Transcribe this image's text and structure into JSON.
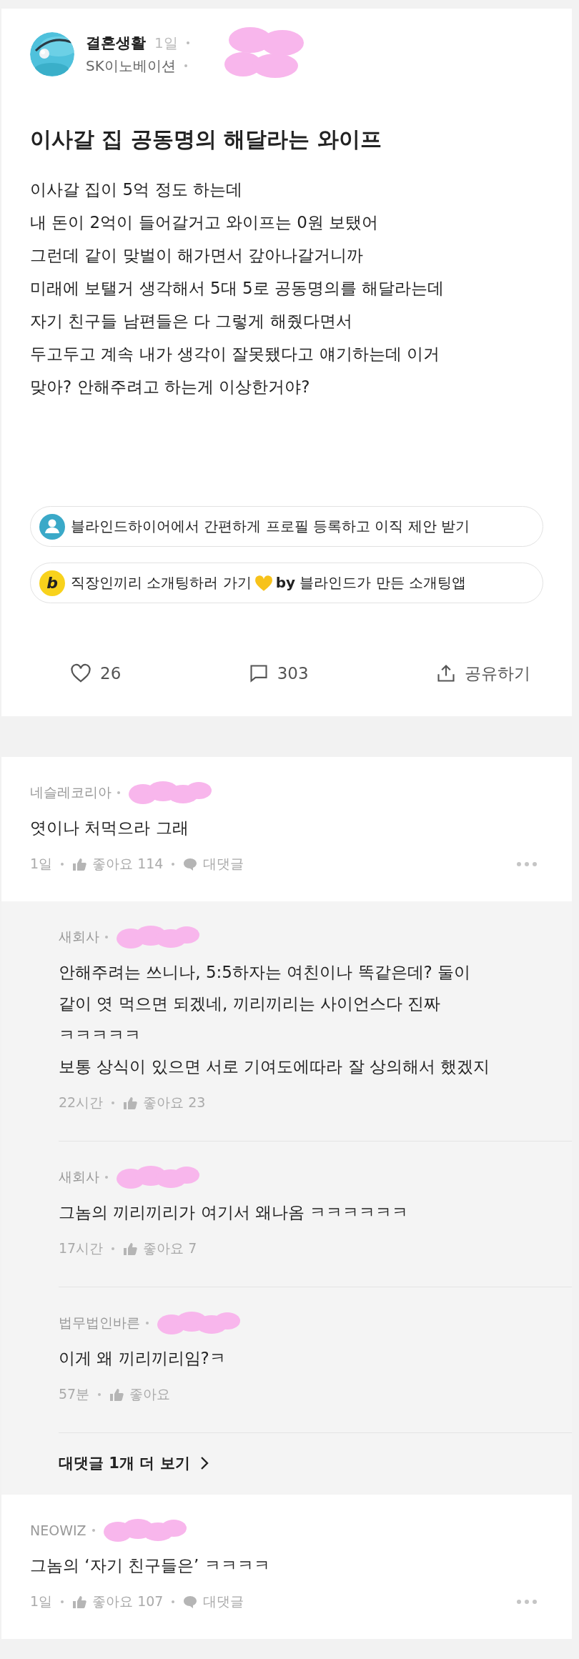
{
  "post": {
    "board": "결혼생활",
    "time": "1일",
    "company": "SK이노베이션",
    "author_redacted": true,
    "title": "이사갈 집 공동명의 해달라는 와이프",
    "body": [
      "이사갈 집이 5억 정도 하는데",
      "내 돈이 2억이 들어갈거고 와이프는 0원 보탰어",
      "그런데 같이 맞벌이 해가면서 갚아나갈거니까",
      "미래에 보탤거 생각해서 5대 5로 공동명의를 해달라는데",
      "자기 친구들 남편들은 다 그렇게 해줬다면서",
      "두고두고 계속 내가 생각이 잘못됐다고 얘기하는데 이거",
      "맞아? 안해주려고 하는게 이상한거야?"
    ],
    "promos": [
      {
        "kind": "profile",
        "text": "블라인드하이어에서 간편하게 프로필 등록하고 이직 제안 받기"
      },
      {
        "kind": "dating",
        "badge": "b",
        "text": "직장인끼리 소개팅하러 가기",
        "heart": true,
        "tail": "**by** 블라인드가 만든 소개팅앱"
      }
    ],
    "likes": "26",
    "comments": "303",
    "share": "공유하기"
  },
  "comments": [
    {
      "company": "네슬레코리아",
      "redacted": true,
      "text": [
        "엿이나 처먹으라 그래"
      ],
      "time": "1일",
      "likes": "좋아요 114",
      "reply_label": "대댓글",
      "replies": [
        {
          "company": "새회사",
          "redacted": true,
          "text": [
            "안해주려는 쓰니나, 5:5하자는 여친이나 똑같은데? 둘이",
            "같이 엿 먹으면 되겠네,  끼리끼리는 사이언스다 진짜",
            "ㅋㅋㅋㅋㅋ",
            "보통 상식이 있으면 서로 기여도에따라 잘 상의해서 했겠지"
          ],
          "time": "22시간",
          "likes": "좋아요 23"
        },
        {
          "company": "새회사",
          "redacted": true,
          "text": [
            "그놈의 끼리끼리가 여기서 왜나옴 ㅋㅋㅋㅋㅋㅋ"
          ],
          "time": "17시간",
          "likes": "좋아요 7"
        },
        {
          "company": "법무법인바른",
          "redacted": true,
          "text": [
            "이게 왜 끼리끼리임?ㅋ"
          ],
          "time": "57분",
          "likes": "좋아요"
        }
      ],
      "more_replies": "대댓글 1개 더 보기"
    },
    {
      "company": "NEOWIZ",
      "redacted": true,
      "text": [
        "그놈의 ‘자기 친구들은’ ㅋㅋㅋㅋ"
      ],
      "time": "1일",
      "likes": "좋아요 107",
      "reply_label": "대댓글"
    }
  ]
}
